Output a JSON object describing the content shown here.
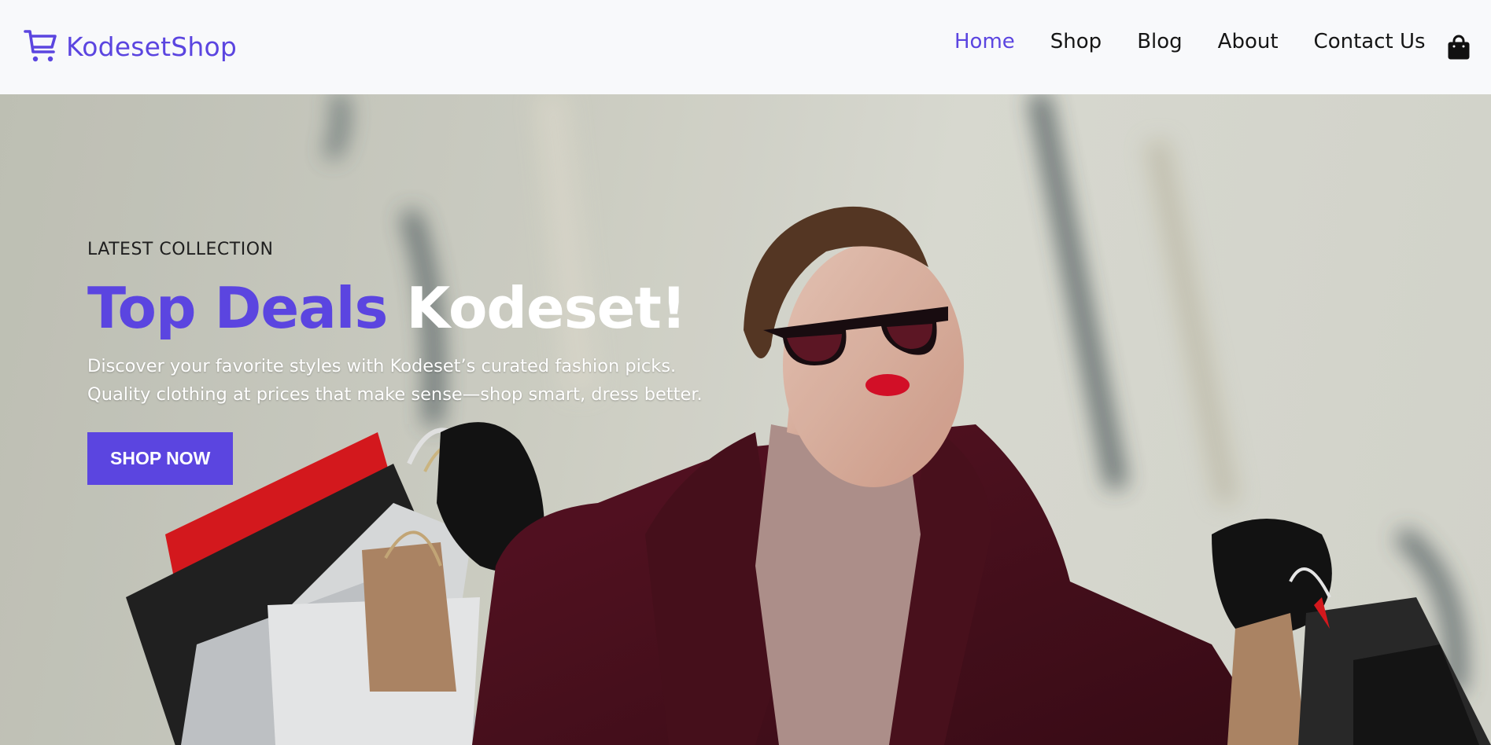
{
  "header": {
    "brand": {
      "name": "KodesetShop",
      "icon": "cart-icon"
    },
    "nav": [
      {
        "label": "Home",
        "active": true
      },
      {
        "label": "Shop",
        "active": false
      },
      {
        "label": "Blog",
        "active": false
      },
      {
        "label": "About",
        "active": false
      },
      {
        "label": "Contact Us",
        "active": false
      }
    ],
    "cart_icon": "shopping-bag-icon"
  },
  "hero": {
    "eyebrow": "LATEST COLLECTION",
    "headline_accent": "Top Deals",
    "headline_rest": "Kodeset!",
    "description": "Discover your favorite styles with Kodeset’s curated fashion picks. Quality clothing at prices that make sense—shop smart, dress better.",
    "cta_label": "SHOP NOW"
  },
  "colors": {
    "accent": "#5b45e0",
    "header_bg": "#f8f9fb",
    "nav_text": "#161616",
    "headline_rest": "#ffffff"
  }
}
